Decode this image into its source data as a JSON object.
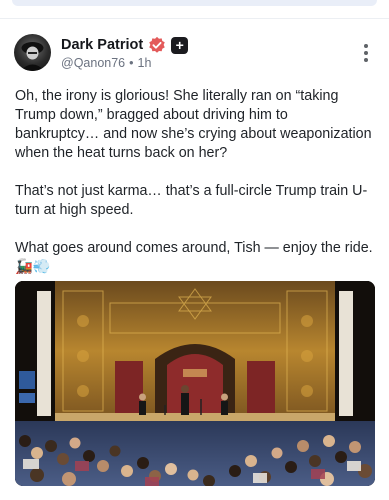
{
  "post": {
    "author": {
      "name": "Dark Patriot",
      "handle": "@Qanon76",
      "separator": "•",
      "time": "1h",
      "avatar_icon": "dark-hooded-figure-avatar",
      "verified_icon": "verified-badge-icon",
      "verified_color": "#e35a5a",
      "plus_icon": "plus-badge-icon",
      "plus_symbol": "+"
    },
    "more_icon": "vertical-ellipsis-icon",
    "paragraphs": [
      "Oh, the irony is glorious! She literally ran on “taking Trump down,” bragged about driving him to bankruptcy… and now she’s crying about weaponization when the heat turns back on her?",
      "That’s not just karma… that’s a full-circle Trump train U-turn at high speed.",
      "What goes around comes around, Tish — enjoy the ride. 🚂💨"
    ],
    "image": {
      "description_icon": "ornate-theater-stage-photo",
      "colors": {
        "stage_gold": "#b8862f",
        "floor_blue": "#3f4f76",
        "dark": "#1a1410"
      }
    }
  }
}
